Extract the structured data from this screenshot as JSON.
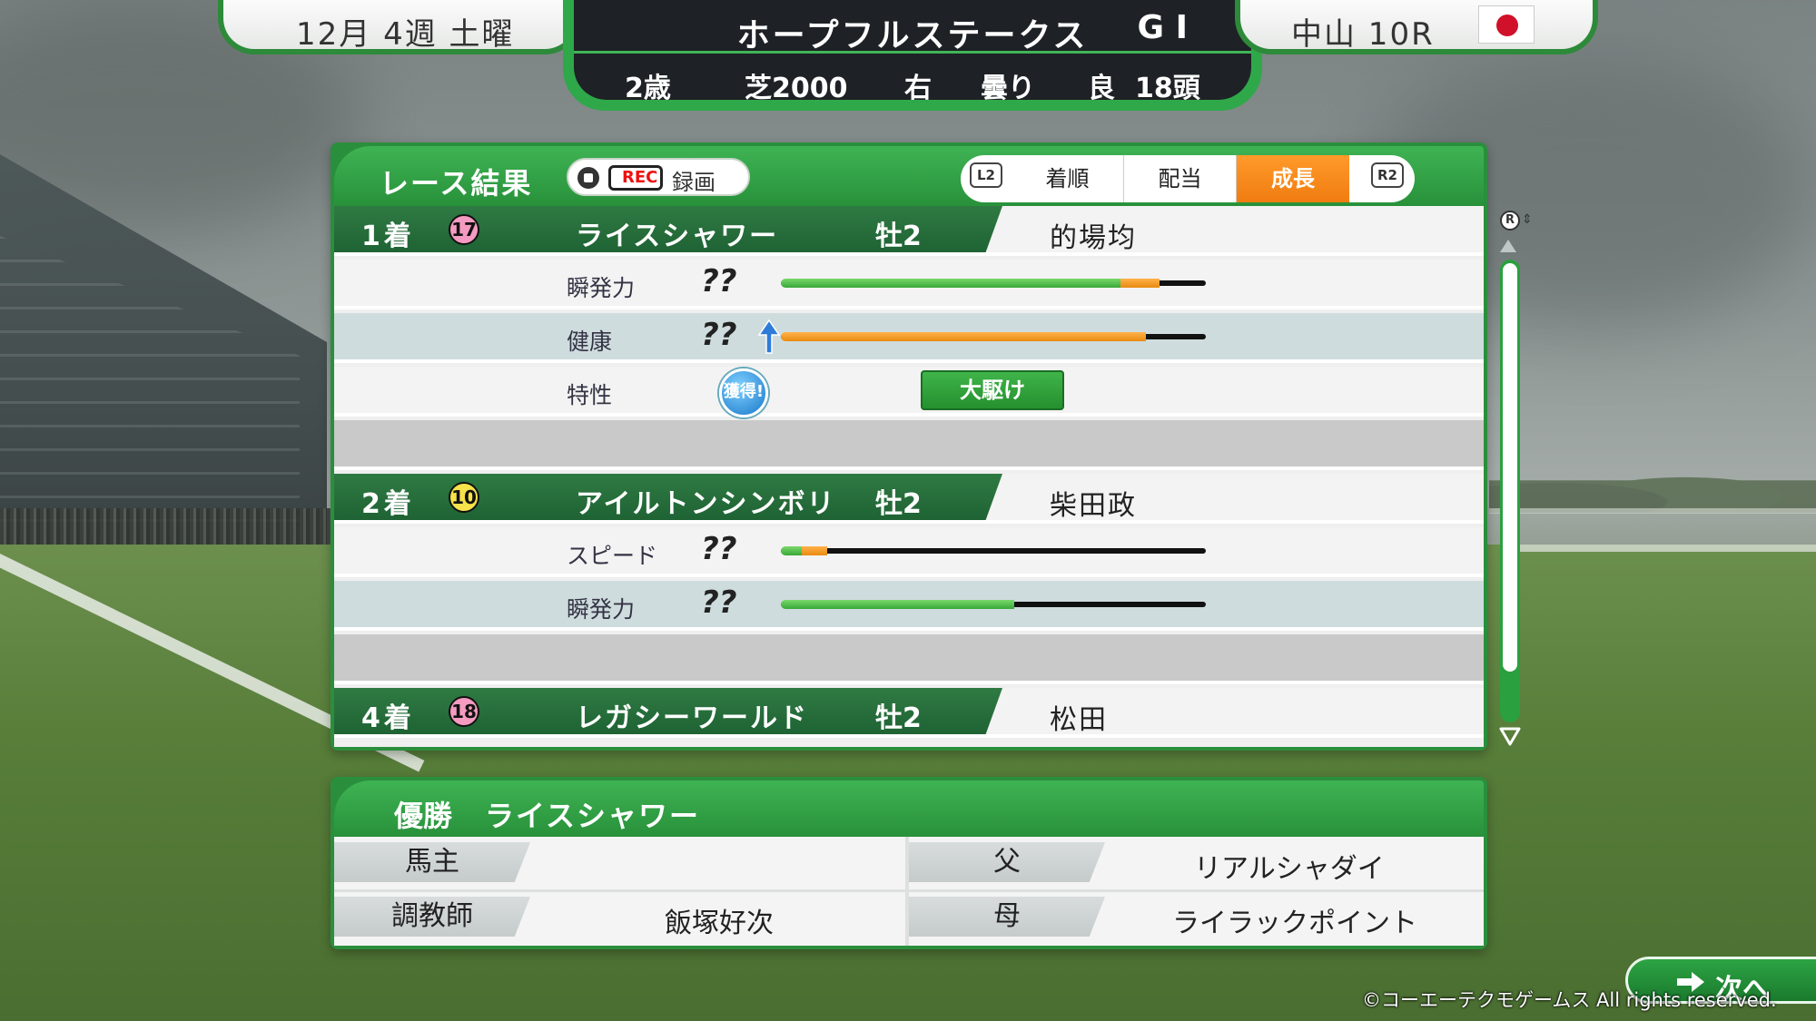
{
  "header": {
    "date": "12月 4週 土曜",
    "race_name": "ホープフルステークス",
    "grade": "G I",
    "venue_race": "中山  10R",
    "conditions": {
      "age": "2歳",
      "surface_distance": "芝2000",
      "direction": "右",
      "weather": "曇り",
      "going": "良",
      "field_size": "18頭"
    }
  },
  "panel": {
    "title": "レース結果",
    "record": {
      "rec_badge": "REC",
      "label": "録画"
    },
    "tabs": {
      "left_button": "L2",
      "right_button": "R2",
      "items": [
        "着順",
        "配当",
        "成長"
      ],
      "active": "成長"
    }
  },
  "results": [
    {
      "place": "1着",
      "number": "17",
      "horse": "ライスシャワー",
      "sex_age": "牡2",
      "jockey": "的場均",
      "stats": [
        {
          "label": "瞬発力",
          "value": "??",
          "green_fraction": 0.8,
          "orange_fraction": 0.09
        },
        {
          "label": "健康",
          "value": "??",
          "arrow": "up",
          "orange_fraction": 0.86
        }
      ],
      "trait": {
        "label": "特性",
        "badge": "獲得!",
        "name": "大駆け"
      }
    },
    {
      "place": "2着",
      "number": "10",
      "horse": "アイルトンシンボリ",
      "sex_age": "牡2",
      "jockey": "柴田政",
      "stats": [
        {
          "label": "スピード",
          "value": "??",
          "green_fraction": 0.05,
          "orange_fraction": 0.06
        },
        {
          "label": "瞬発力",
          "value": "??",
          "green_fraction": 0.55,
          "orange_fraction": 0.0
        }
      ]
    },
    {
      "place": "4着",
      "number": "18",
      "horse": "レガシーワールド",
      "sex_age": "牡2",
      "jockey": "松田"
    }
  ],
  "scroll": {
    "button": "R"
  },
  "winner": {
    "label": "優勝",
    "horse": "ライスシャワー",
    "owner_key": "馬主",
    "owner_value": "",
    "trainer_key": "調教師",
    "trainer_value": "飯塚好次",
    "sire_key": "父",
    "sire_value": "リアルシャダイ",
    "dam_key": "母",
    "dam_value": "ライラックポイント"
  },
  "footer": {
    "next_label": "次へ",
    "copyright": "©コーエーテクモゲームス All rights reserved."
  },
  "colors": {
    "panel_green": "#2a8f3c",
    "active_tab": "#f07c10",
    "number_pink": "#f59ac0",
    "number_yellow": "#f6e24a",
    "bar_green": "#38a83a",
    "bar_orange": "#e88a10"
  }
}
